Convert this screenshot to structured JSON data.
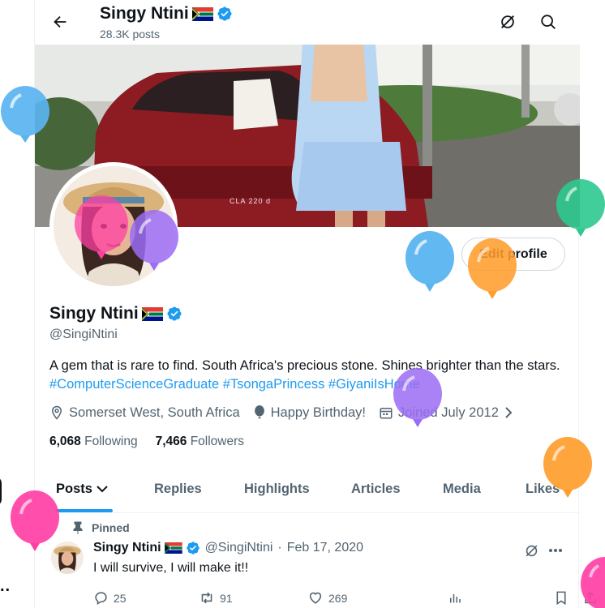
{
  "header": {
    "name": "Singy Ntini",
    "posts_count": "28.3K posts"
  },
  "profile": {
    "name": "Singy Ntini",
    "handle": "@SingiNtini",
    "edit_button": "Edit profile",
    "bio_text": "A gem that is rare to find. South Africa's precious stone. Shines brighter than the stars.",
    "bio_hashtags": [
      "#ComputerScienceGraduate",
      "#TsongaPrincess",
      "#GiyaniIsHome"
    ],
    "location": "Somerset West, South Africa",
    "birthday": "Happy Birthday!",
    "joined": "Joined July 2012",
    "following_count": "6,068",
    "following_label": "Following",
    "followers_count": "7,466",
    "followers_label": "Followers",
    "banner_text": "CLA 220 d"
  },
  "tabs": [
    {
      "label": "Posts",
      "active": true
    },
    {
      "label": "Replies",
      "active": false
    },
    {
      "label": "Highlights",
      "active": false
    },
    {
      "label": "Articles",
      "active": false
    },
    {
      "label": "Media",
      "active": false
    },
    {
      "label": "Likes",
      "active": false
    }
  ],
  "pinned_post": {
    "pinned_label": "Pinned",
    "author_name": "Singy Ntini",
    "author_handle": "@SingiNtini",
    "date": "Feb 17, 2020",
    "separator": "·",
    "text": "I will survive, I will make it!!",
    "replies": "25",
    "reposts": "91",
    "likes": "269"
  },
  "edge_text": "..",
  "colors": {
    "accent": "#1d9bf0",
    "balloon_blue": "#5ab4f0",
    "balloon_orange": "#ff9d2e",
    "balloon_purple": "#9b6cf5",
    "balloon_pink": "#ff3fa4",
    "balloon_green": "#2ec98f"
  }
}
